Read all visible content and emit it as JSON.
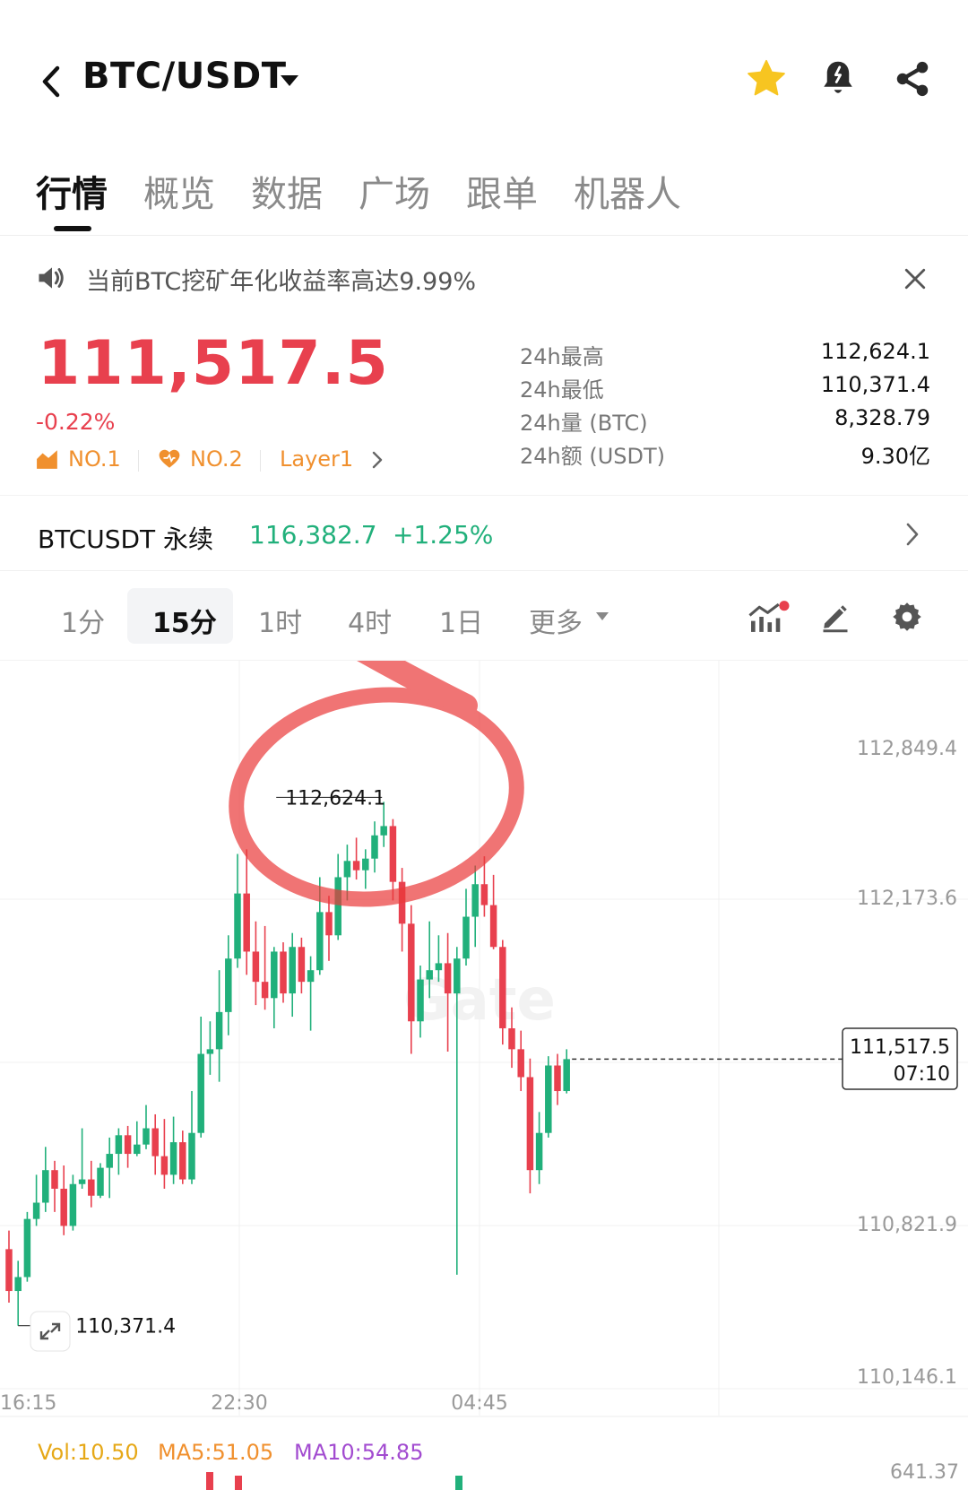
{
  "header": {
    "title": "BTC/USDT"
  },
  "tabs": [
    {
      "label": "行情",
      "active": true
    },
    {
      "label": "概览"
    },
    {
      "label": "数据"
    },
    {
      "label": "广场"
    },
    {
      "label": "跟单"
    },
    {
      "label": "机器人"
    }
  ],
  "notice": {
    "text": "当前BTC挖矿年化收益率高达9.99%"
  },
  "ticker": {
    "price": "111,517.5",
    "change": "-0.22%",
    "badges": [
      "NO.1",
      "NO.2",
      "Layer1"
    ],
    "stats": [
      {
        "label": "24h最高",
        "value": "112,624.1"
      },
      {
        "label": "24h最低",
        "value": "110,371.4"
      },
      {
        "label": "24h量 (BTC)",
        "value": "8,328.79"
      },
      {
        "label": "24h额 (USDT)",
        "value": "9.30亿"
      }
    ]
  },
  "perpetual": {
    "name": "BTCUSDT 永续",
    "price": "116,382.7",
    "change": "+1.25%"
  },
  "intervals": [
    {
      "label": "1分"
    },
    {
      "label": "15分",
      "active": true
    },
    {
      "label": "1时"
    },
    {
      "label": "4时"
    },
    {
      "label": "1日"
    },
    {
      "label": "更多"
    }
  ],
  "chart_data": {
    "type": "candlestick",
    "y_ticks": [
      "112,849.4",
      "112,173.6",
      "110,821.9",
      "110,146.1"
    ],
    "x_ticks": [
      "16:15",
      "22:30",
      "04:45"
    ],
    "high_label": "112,624.1",
    "low_label": "110,371.4",
    "current": {
      "price": "111,517.5",
      "time": "07:10"
    },
    "watermark": "Gate",
    "colors": {
      "up": "#21b07b",
      "down": "#e8404e"
    },
    "candles": [
      {
        "o": 110700,
        "h": 110780,
        "l": 110470,
        "c": 110520
      },
      {
        "o": 110520,
        "h": 110650,
        "l": 110371,
        "c": 110580
      },
      {
        "o": 110580,
        "h": 110860,
        "l": 110560,
        "c": 110830
      },
      {
        "o": 110830,
        "h": 111020,
        "l": 110800,
        "c": 110900
      },
      {
        "o": 110900,
        "h": 111140,
        "l": 110860,
        "c": 111040
      },
      {
        "o": 111040,
        "h": 111080,
        "l": 110860,
        "c": 110960
      },
      {
        "o": 110960,
        "h": 111060,
        "l": 110760,
        "c": 110800
      },
      {
        "o": 110800,
        "h": 111020,
        "l": 110780,
        "c": 110980
      },
      {
        "o": 110980,
        "h": 111220,
        "l": 110960,
        "c": 111000
      },
      {
        "o": 111000,
        "h": 111080,
        "l": 110880,
        "c": 110930
      },
      {
        "o": 110930,
        "h": 111070,
        "l": 110920,
        "c": 111050
      },
      {
        "o": 111050,
        "h": 111180,
        "l": 110920,
        "c": 111110
      },
      {
        "o": 111110,
        "h": 111220,
        "l": 111020,
        "c": 111190
      },
      {
        "o": 111190,
        "h": 111230,
        "l": 111050,
        "c": 111110
      },
      {
        "o": 111110,
        "h": 111250,
        "l": 111100,
        "c": 111150
      },
      {
        "o": 111150,
        "h": 111320,
        "l": 111130,
        "c": 111220
      },
      {
        "o": 111220,
        "h": 111280,
        "l": 111020,
        "c": 111100
      },
      {
        "o": 111100,
        "h": 111260,
        "l": 110960,
        "c": 111020
      },
      {
        "o": 111020,
        "h": 111270,
        "l": 110980,
        "c": 111160
      },
      {
        "o": 111160,
        "h": 111210,
        "l": 110980,
        "c": 111000
      },
      {
        "o": 111000,
        "h": 111380,
        "l": 110980,
        "c": 111200
      },
      {
        "o": 111200,
        "h": 111700,
        "l": 111180,
        "c": 111540
      },
      {
        "o": 111540,
        "h": 111680,
        "l": 111450,
        "c": 111560
      },
      {
        "o": 111560,
        "h": 111900,
        "l": 111420,
        "c": 111720
      },
      {
        "o": 111720,
        "h": 112050,
        "l": 111620,
        "c": 111950
      },
      {
        "o": 111950,
        "h": 112400,
        "l": 111910,
        "c": 112230
      },
      {
        "o": 112230,
        "h": 112420,
        "l": 111880,
        "c": 111980
      },
      {
        "o": 111980,
        "h": 112110,
        "l": 111750,
        "c": 111850
      },
      {
        "o": 111850,
        "h": 112090,
        "l": 111730,
        "c": 111780
      },
      {
        "o": 111780,
        "h": 112000,
        "l": 111650,
        "c": 111980
      },
      {
        "o": 111980,
        "h": 112020,
        "l": 111760,
        "c": 111800
      },
      {
        "o": 111800,
        "h": 112060,
        "l": 111700,
        "c": 112000
      },
      {
        "o": 112000,
        "h": 112040,
        "l": 111800,
        "c": 111850
      },
      {
        "o": 111850,
        "h": 111960,
        "l": 111640,
        "c": 111900
      },
      {
        "o": 111900,
        "h": 112300,
        "l": 111880,
        "c": 112150
      },
      {
        "o": 112150,
        "h": 112220,
        "l": 111940,
        "c": 112050
      },
      {
        "o": 112050,
        "h": 112400,
        "l": 112030,
        "c": 112300
      },
      {
        "o": 112300,
        "h": 112440,
        "l": 112200,
        "c": 112370
      },
      {
        "o": 112370,
        "h": 112470,
        "l": 112290,
        "c": 112330
      },
      {
        "o": 112330,
        "h": 112420,
        "l": 112250,
        "c": 112380
      },
      {
        "o": 112380,
        "h": 112540,
        "l": 112320,
        "c": 112480
      },
      {
        "o": 112480,
        "h": 112624,
        "l": 112430,
        "c": 112520
      },
      {
        "o": 112520,
        "h": 112550,
        "l": 112200,
        "c": 112280
      },
      {
        "o": 112280,
        "h": 112340,
        "l": 111980,
        "c": 112100
      },
      {
        "o": 112100,
        "h": 112180,
        "l": 111540,
        "c": 111680
      },
      {
        "o": 111680,
        "h": 111920,
        "l": 111610,
        "c": 111860
      },
      {
        "o": 111860,
        "h": 112110,
        "l": 111780,
        "c": 111900
      },
      {
        "o": 111900,
        "h": 112050,
        "l": 111850,
        "c": 111930
      },
      {
        "o": 111930,
        "h": 112060,
        "l": 111550,
        "c": 111800
      },
      {
        "o": 111800,
        "h": 112000,
        "l": 110590,
        "c": 111950
      },
      {
        "o": 111950,
        "h": 112250,
        "l": 111920,
        "c": 112130
      },
      {
        "o": 112130,
        "h": 112350,
        "l": 112000,
        "c": 112270
      },
      {
        "o": 112270,
        "h": 112390,
        "l": 112130,
        "c": 112180
      },
      {
        "o": 112180,
        "h": 112310,
        "l": 111990,
        "c": 112000
      },
      {
        "o": 112000,
        "h": 112030,
        "l": 111580,
        "c": 111650
      },
      {
        "o": 111650,
        "h": 111740,
        "l": 111480,
        "c": 111560
      },
      {
        "o": 111560,
        "h": 111640,
        "l": 111380,
        "c": 111440
      },
      {
        "o": 111440,
        "h": 111520,
        "l": 110940,
        "c": 111040
      },
      {
        "o": 111040,
        "h": 111290,
        "l": 110980,
        "c": 111200
      },
      {
        "o": 111200,
        "h": 111530,
        "l": 111180,
        "c": 111490
      },
      {
        "o": 111490,
        "h": 111540,
        "l": 111320,
        "c": 111380
      },
      {
        "o": 111380,
        "h": 111560,
        "l": 111370,
        "c": 111517.5
      }
    ]
  },
  "volume": {
    "vol": "Vol:10.50",
    "ma5": "MA5:51.05",
    "ma10": "MA10:54.85",
    "axis": "641.37"
  }
}
